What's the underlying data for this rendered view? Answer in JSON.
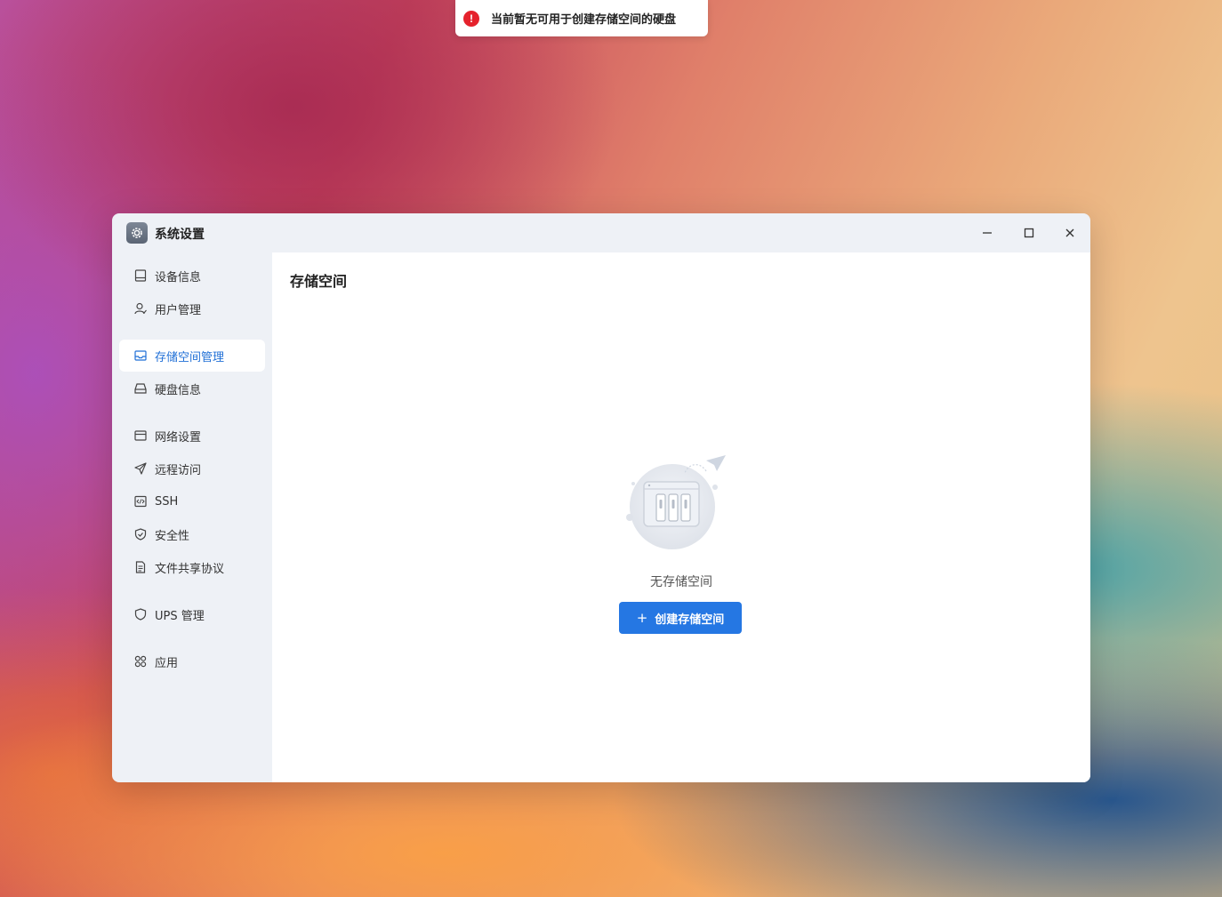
{
  "toast": {
    "message": "当前暂无可用于创建存储空间的硬盘",
    "icon": "error-icon",
    "color": "#e5222c"
  },
  "window": {
    "title": "系统设置",
    "app_icon": "settings-gear-icon",
    "controls": [
      "minimize",
      "maximize",
      "close"
    ]
  },
  "sidebar": {
    "items": [
      {
        "label": "设备信息",
        "icon": "device-icon"
      },
      {
        "label": "用户管理",
        "icon": "user-icon"
      },
      {
        "label": "存储空间管理",
        "icon": "storage-icon",
        "active": true
      },
      {
        "label": "硬盘信息",
        "icon": "disk-icon"
      },
      {
        "label": "网络设置",
        "icon": "network-icon"
      },
      {
        "label": "远程访问",
        "icon": "send-icon"
      },
      {
        "label": "SSH",
        "icon": "code-icon"
      },
      {
        "label": "安全性",
        "icon": "shield-check-icon"
      },
      {
        "label": "文件共享协议",
        "icon": "document-icon"
      },
      {
        "label": "UPS 管理",
        "icon": "shield-icon"
      },
      {
        "label": "应用",
        "icon": "apps-icon"
      }
    ]
  },
  "main": {
    "title": "存储空间",
    "empty_text": "无存储空间",
    "create_button": "创建存储空间",
    "accent": "#2577e3"
  }
}
